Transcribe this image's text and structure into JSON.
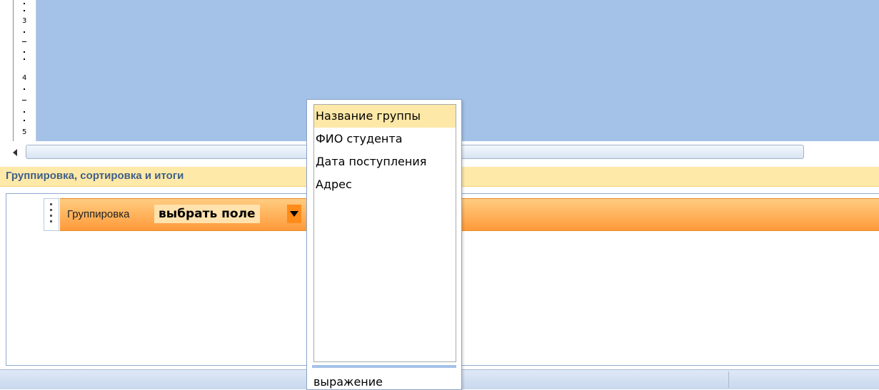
{
  "ruler": {
    "labels": [
      "3",
      "4",
      "5"
    ]
  },
  "panel": {
    "header_title": "Группировка, сортировка и итоги",
    "grouping_label": "Группировка",
    "field_select_value": "выбрать поле"
  },
  "dropdown": {
    "items": [
      "Название группы",
      "ФИО студента",
      "Дата поступления",
      "Адрес"
    ],
    "selected_index": 0,
    "expression_label": "выражение"
  },
  "colors": {
    "design_canvas": "#a4c2e8",
    "header_bg": "#ffe9a8",
    "header_text": "#3f5f88",
    "group_row": "#ff9a3a",
    "selected_item": "#fde8a7"
  }
}
